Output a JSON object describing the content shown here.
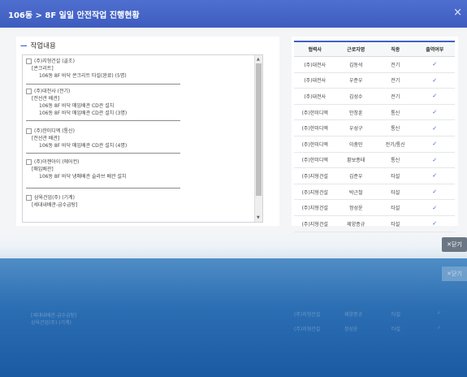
{
  "window": {
    "title": "106동 > 8F 일일 안전작업 진행현황",
    "close_glyph": "×"
  },
  "work_section": {
    "header": "작업내용",
    "groups": [
      {
        "company": "(주)지형건설 (골조)",
        "category": "[콘크리트]",
        "items": [
          "106동 8F 바닥 콘크리트 타설(완료) (5명)"
        ]
      },
      {
        "company": "(주)대전사 (전기)",
        "category": "[전선관 배관]",
        "items": [
          "106동 8F 바닥 매입배관 CD관 설치",
          "106동 8F 바닥 매입배관 CD관 설치 (3명)"
        ]
      },
      {
        "company": "(주)한미디엑 (통신)",
        "category": "[전선관 배관]",
        "items": [
          "106동 8F 바닥 매입배관 CD관 설치 (4명)"
        ]
      },
      {
        "company": "(주)이젠아이 (에어컨)",
        "category": "[매입배관]",
        "items": [
          "106동 8F 바닥 냉매배관 슬라브 배관 설치"
        ]
      },
      {
        "company": "삼육건업(주) (기계)",
        "category": "[세대내배관-급수급탕]",
        "items": []
      }
    ]
  },
  "worker_table": {
    "headers": [
      "협력사",
      "근로자명",
      "직종",
      "출역여부"
    ],
    "rows": [
      [
        "(주)대전사",
        "김동석",
        "전기",
        "✓"
      ],
      [
        "(주)대전사",
        "우준우",
        "전기",
        "✓"
      ],
      [
        "(주)대전사",
        "김성수",
        "전기",
        "✓"
      ],
      [
        "(주)한미디엑",
        "안창훈",
        "통신",
        "✓"
      ],
      [
        "(주)한미디엑",
        "우성구",
        "통신",
        "✓"
      ],
      [
        "(주)한미디엑",
        "이충민",
        "전기/통신",
        "✓"
      ],
      [
        "(주)한미디엑",
        "황보종태",
        "통신",
        "✓"
      ],
      [
        "(주)지형건설",
        "김준우",
        "타설",
        "✓"
      ],
      [
        "(주)지형건설",
        "박근철",
        "타설",
        "✓"
      ],
      [
        "(주)지형건설",
        "정성윤",
        "타설",
        "✓"
      ],
      [
        "(주)지형건설",
        "제양종규",
        "타설",
        "✓"
      ]
    ]
  },
  "buttons": {
    "close": "✕닫기"
  },
  "background_reflection": {
    "list_lines": [
      "[세대내배관-급수급탕]",
      "삼육건업(주) (기계)"
    ],
    "table_rows": [
      [
        "(주)지형건설",
        "제양종규",
        "타설",
        "✓"
      ],
      [
        "(주)지형건설",
        "정성윤",
        "타설",
        "✓"
      ]
    ]
  },
  "colors": {
    "accent": "#3f62c4",
    "button": "#6a7683"
  }
}
